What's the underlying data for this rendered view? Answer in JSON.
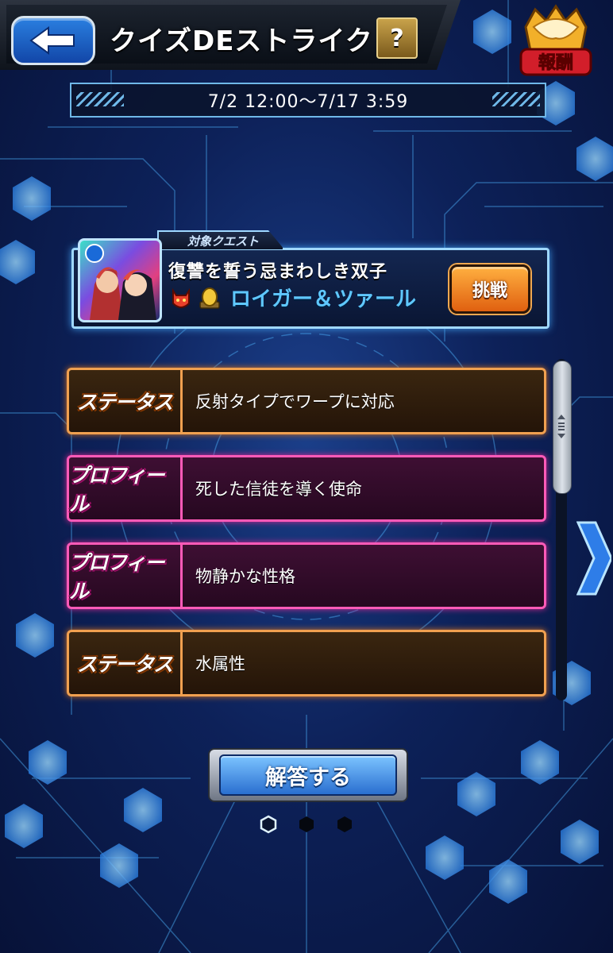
{
  "header": {
    "title": "クイズDEストライク",
    "help_label": "?",
    "reward_badge_label": "報酬"
  },
  "event": {
    "date_range": "7/2 12:00〜7/17 3:59"
  },
  "quest": {
    "tab_label": "対象クエスト",
    "name": "復讐を誓う忌まわしき双子",
    "boss": "ロイガー＆ツァール",
    "challenge_label": "挑戦"
  },
  "hints": [
    {
      "type": "status",
      "tag": "ステータス",
      "text": "反射タイプでワープに対応"
    },
    {
      "type": "profile",
      "tag": "プロフィール",
      "text": "死した信徒を導く使命"
    },
    {
      "type": "profile",
      "tag": "プロフィール",
      "text": "物静かな性格"
    },
    {
      "type": "status",
      "tag": "ステータス",
      "text": "水属性"
    }
  ],
  "answer_button_label": "解答する",
  "pagination": {
    "current": 1,
    "total": 3
  },
  "colors": {
    "status_border": "#f0a050",
    "profile_border": "#ff5ab8",
    "accent_blue": "#5fc8ff",
    "challenge_orange": "#e06010"
  },
  "icons": [
    "back-arrow-icon",
    "help-icon",
    "reward-badge-icon",
    "demon-icon",
    "egg-icon",
    "next-arrow-icon",
    "scroll-grip-icon"
  ]
}
